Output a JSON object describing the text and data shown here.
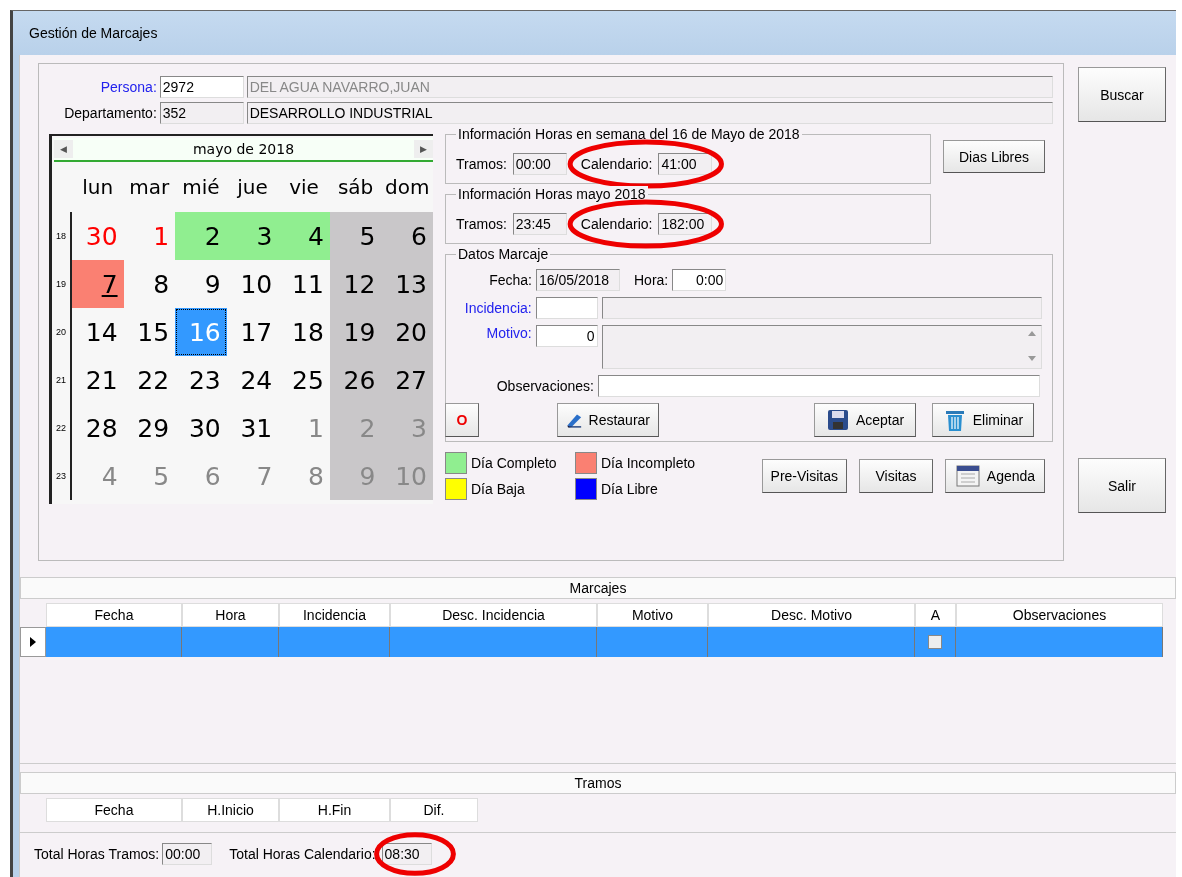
{
  "window": {
    "title": "Gestión de Marcajes"
  },
  "persona": {
    "label": "Persona:",
    "code": "2972",
    "name": "DEL AGUA NAVARRO,JUAN"
  },
  "departamento": {
    "label": "Departamento:",
    "code": "352",
    "name": "DESARROLLO INDUSTRIAL"
  },
  "calendar": {
    "month": "mayo de 2018",
    "prev": "◀",
    "next": "▶",
    "weekdays": [
      "lun",
      "mar",
      "mié",
      "jue",
      "vie",
      "sáb",
      "dom"
    ],
    "weeks": [
      {
        "number": "18",
        "days": [
          {
            "d": "30",
            "kind": "holiday",
            "selected": false,
            "today": false
          },
          {
            "d": "1",
            "kind": "holiday",
            "selected": false,
            "today": false
          },
          {
            "d": "2",
            "kind": "complete",
            "selected": false,
            "today": false
          },
          {
            "d": "3",
            "kind": "complete",
            "selected": false,
            "today": false
          },
          {
            "d": "4",
            "kind": "complete",
            "selected": false,
            "today": false
          },
          {
            "d": "5",
            "kind": "normal",
            "selected": false,
            "today": false
          },
          {
            "d": "6",
            "kind": "normal",
            "selected": false,
            "today": false
          }
        ]
      },
      {
        "number": "19",
        "days": [
          {
            "d": "7",
            "kind": "incomplete",
            "selected": false,
            "today": true
          },
          {
            "d": "8",
            "kind": "normal",
            "selected": false,
            "today": false
          },
          {
            "d": "9",
            "kind": "normal",
            "selected": false,
            "today": false
          },
          {
            "d": "10",
            "kind": "normal",
            "selected": false,
            "today": false
          },
          {
            "d": "11",
            "kind": "normal",
            "selected": false,
            "today": false
          },
          {
            "d": "12",
            "kind": "normal",
            "selected": false,
            "today": false
          },
          {
            "d": "13",
            "kind": "normal",
            "selected": false,
            "today": false
          }
        ]
      },
      {
        "number": "20",
        "days": [
          {
            "d": "14",
            "kind": "normal",
            "selected": false,
            "today": false
          },
          {
            "d": "15",
            "kind": "normal",
            "selected": false,
            "today": false
          },
          {
            "d": "16",
            "kind": "normal",
            "selected": true,
            "today": false
          },
          {
            "d": "17",
            "kind": "normal",
            "selected": false,
            "today": false
          },
          {
            "d": "18",
            "kind": "normal",
            "selected": false,
            "today": false
          },
          {
            "d": "19",
            "kind": "normal",
            "selected": false,
            "today": false
          },
          {
            "d": "20",
            "kind": "normal",
            "selected": false,
            "today": false
          }
        ]
      },
      {
        "number": "21",
        "days": [
          {
            "d": "21",
            "kind": "normal",
            "selected": false,
            "today": false
          },
          {
            "d": "22",
            "kind": "normal",
            "selected": false,
            "today": false
          },
          {
            "d": "23",
            "kind": "normal",
            "selected": false,
            "today": false
          },
          {
            "d": "24",
            "kind": "normal",
            "selected": false,
            "today": false
          },
          {
            "d": "25",
            "kind": "normal",
            "selected": false,
            "today": false
          },
          {
            "d": "26",
            "kind": "normal",
            "selected": false,
            "today": false
          },
          {
            "d": "27",
            "kind": "normal",
            "selected": false,
            "today": false
          }
        ]
      },
      {
        "number": "22",
        "days": [
          {
            "d": "28",
            "kind": "normal",
            "selected": false,
            "today": false
          },
          {
            "d": "29",
            "kind": "normal",
            "selected": false,
            "today": false
          },
          {
            "d": "30",
            "kind": "normal",
            "selected": false,
            "today": false
          },
          {
            "d": "31",
            "kind": "normal",
            "selected": false,
            "today": false
          },
          {
            "d": "1",
            "kind": "other",
            "selected": false,
            "today": false
          },
          {
            "d": "2",
            "kind": "other",
            "selected": false,
            "today": false
          },
          {
            "d": "3",
            "kind": "other",
            "selected": false,
            "today": false
          }
        ]
      },
      {
        "number": "23",
        "days": [
          {
            "d": "4",
            "kind": "other",
            "selected": false,
            "today": false
          },
          {
            "d": "5",
            "kind": "other",
            "selected": false,
            "today": false
          },
          {
            "d": "6",
            "kind": "other",
            "selected": false,
            "today": false
          },
          {
            "d": "7",
            "kind": "other",
            "selected": false,
            "today": false
          },
          {
            "d": "8",
            "kind": "other",
            "selected": false,
            "today": false
          },
          {
            "d": "9",
            "kind": "other",
            "selected": false,
            "today": false
          },
          {
            "d": "10",
            "kind": "other",
            "selected": false,
            "today": false
          }
        ]
      }
    ]
  },
  "week_info": {
    "title": "Información Horas en semana del 16 de Mayo de 2018",
    "tramos_label": "Tramos:",
    "tramos": "00:00",
    "calendario_label": "Calendario:",
    "calendario": "41:00",
    "circled": true
  },
  "month_info": {
    "title": "Información Horas mayo 2018",
    "tramos_label": "Tramos:",
    "tramos": "23:45",
    "calendario_label": "Calendario:",
    "calendario": "182:00",
    "circled": true
  },
  "search_button": "Buscar",
  "free_days_button": "Dias Libres",
  "exit_button": "Salir",
  "datos_marcaje": {
    "title": "Datos Marcaje",
    "fecha_label": "Fecha:",
    "fecha": "16/05/2018",
    "hora_label": "Hora:",
    "hora": "0:00",
    "incidencia_label": "Incidencia:",
    "motivo_label": "Motivo:",
    "motivo": "0",
    "observaciones_label": "Observaciones:"
  },
  "actions": [
    {
      "kind": "o",
      "label": "O"
    },
    {
      "kind": "restore",
      "label": "Restaurar"
    },
    {
      "kind": "save",
      "label": "Aceptar"
    },
    {
      "kind": "delete",
      "label": "Eliminar"
    }
  ],
  "legend": [
    {
      "label": "Día Completo",
      "color": "#90ee90"
    },
    {
      "label": "Día Incompleto",
      "color": "#fa8072"
    },
    {
      "label": "Día Baja",
      "color": "#ffff00"
    },
    {
      "label": "Día Libre",
      "color": "#0000ff"
    }
  ],
  "nav_buttons": [
    {
      "kind": "plain",
      "label": "Pre-Visitas"
    },
    {
      "kind": "plain",
      "label": "Visitas"
    },
    {
      "kind": "calendar",
      "label": "Agenda"
    }
  ],
  "marcajes": {
    "title": "Marcajes",
    "columns": [
      "Fecha",
      "Hora",
      "Incidencia",
      "Desc. Incidencia",
      "Motivo",
      "Desc. Motivo",
      "A",
      "Observaciones"
    ],
    "rows": [
      {
        "selected": true,
        "a_checked": false
      }
    ]
  },
  "tramos": {
    "title": "Tramos",
    "columns": [
      "Fecha",
      "H.Inicio",
      "H.Fin",
      "Dif."
    ]
  },
  "totals": {
    "tramos_label": "Total Horas Tramos:",
    "tramos": "00:00",
    "calendario_label": "Total Horas Calendario:",
    "calendario": "08:30",
    "circled": true
  }
}
